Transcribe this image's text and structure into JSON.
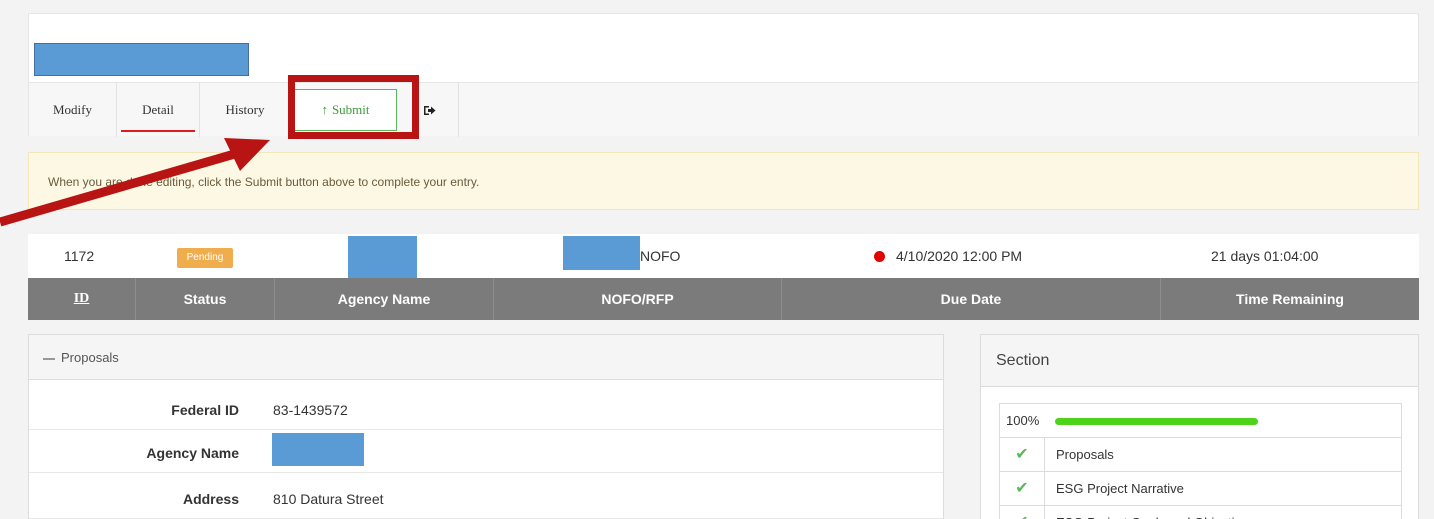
{
  "tabs": {
    "modify": "Modify",
    "detail": "Detail",
    "history": "History",
    "submit_icon": "↑",
    "submit": "Submit",
    "exit_icon": "sign-out-icon"
  },
  "alert": {
    "text": "When you are done editing, click the Submit button above to complete your entry."
  },
  "record": {
    "id": "1172",
    "status": "Pending",
    "nofo_suffix": "NOFO",
    "due_date": "4/10/2020 12:00 PM",
    "time_remaining": "21 days 01:04:00"
  },
  "table_headers": {
    "id": "ID",
    "status": "Status",
    "agency_name": "Agency Name",
    "nofo_rfp": "NOFO/RFP",
    "due_date": "Due Date",
    "time_remaining": "Time Remaining"
  },
  "proposals_panel": {
    "title": "Proposals",
    "fields": [
      {
        "label": "Federal ID",
        "value": "83-1439572"
      },
      {
        "label": "Agency Name",
        "value": ""
      },
      {
        "label": "Address",
        "value": "810 Datura Street"
      }
    ]
  },
  "section_panel": {
    "title": "Section",
    "progress_label": "100%",
    "progress": 1.0,
    "items": [
      {
        "label": "Proposals",
        "done": true
      },
      {
        "label": "ESG Project Narrative",
        "done": true
      },
      {
        "label": "ESG Project Goals and Objectives",
        "done": true
      }
    ]
  },
  "colors": {
    "accent_red": "#b81414",
    "tab_underline": "#e01b1b",
    "submit_green": "#5cb85c",
    "pending_badge": "#f0ad4e",
    "progress_green": "#4cd31a",
    "table_header": "#7b7b7b",
    "redaction": "#5b9bd5"
  }
}
